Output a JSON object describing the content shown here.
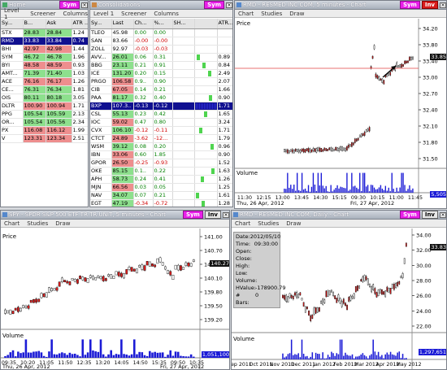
{
  "quotes": {
    "title": "Home",
    "sym_btn": "Sym",
    "menu": [
      "Level 1",
      "Screener",
      "Columns"
    ],
    "columns": [
      "Sy...",
      "B...",
      "Ask",
      "ATR ..."
    ],
    "rows": [
      {
        "sym": "STX",
        "bid": "28.83",
        "ask": "28.84",
        "atr": "1.24",
        "hl": "g"
      },
      {
        "sym": "RMD",
        "bid": "33.83",
        "ask": "33.84",
        "atr": "0.74",
        "hl": "sel"
      },
      {
        "sym": "BHI",
        "bid": "42.97",
        "ask": "42.98",
        "atr": "1.44",
        "hl": "r"
      },
      {
        "sym": "SYM",
        "bid": "46.72",
        "ask": "46.78",
        "atr": "1.96",
        "hl": "g"
      },
      {
        "sym": "BYI",
        "bid": "48.58",
        "ask": "48.59",
        "atr": "0.93",
        "hl": "r"
      },
      {
        "sym": "AMT...",
        "bid": "71.39",
        "ask": "71.40",
        "atr": "1.03",
        "hl": "g"
      },
      {
        "sym": "ACE",
        "bid": "76.16",
        "ask": "76.17",
        "atr": "1.26",
        "hl": "r"
      },
      {
        "sym": "CE...",
        "bid": "76.31",
        "ask": "76.34",
        "atr": "1.81",
        "hl": "g"
      },
      {
        "sym": "OIS",
        "bid": "80.11",
        "ask": "80.18",
        "atr": "3.05",
        "hl": "g"
      },
      {
        "sym": "DLTR",
        "bid": "100.90",
        "ask": "100.94",
        "atr": "1.71",
        "hl": "r"
      },
      {
        "sym": "PPG",
        "bid": "105.54",
        "ask": "105.59",
        "atr": "2.13",
        "hl": "g"
      },
      {
        "sym": "OR...",
        "bid": "105.54",
        "ask": "105.56",
        "atr": "2.34",
        "hl": "g"
      },
      {
        "sym": "PX",
        "bid": "116.08",
        "ask": "116.12",
        "atr": "1.99",
        "hl": "r"
      },
      {
        "sym": "V",
        "bid": "123.31",
        "ask": "123.34",
        "atr": "2.51",
        "hl": "r"
      }
    ]
  },
  "consol": {
    "title": "Consolidations",
    "sym_btn": "Sym",
    "menu": [
      "Level 1",
      "Screener",
      "Columns"
    ],
    "columns": [
      "Sy...",
      "Last",
      "Ch...",
      "%...",
      "SH...",
      "",
      "ATR..."
    ],
    "rows": [
      {
        "sym": "TLEO",
        "last": "45.98",
        "ch": "0.00",
        "pct": "0.00",
        "atr": "",
        "hl": ""
      },
      {
        "sym": "SAN",
        "last": "83.66",
        "ch": "-0.00",
        "pct": "-0.00",
        "atr": "",
        "hl": ""
      },
      {
        "sym": "ZOLL",
        "last": "92.97",
        "ch": "-0.03",
        "pct": "-0.03",
        "atr": "",
        "hl": ""
      },
      {
        "sym": "AVV...",
        "last": "26.01",
        "ch": "0.06",
        "pct": "0.31",
        "atr": "0.89",
        "hl": "g"
      },
      {
        "sym": "BBG",
        "last": "23.11",
        "ch": "0.21",
        "pct": "0.91",
        "atr": "0.84",
        "hl": "g"
      },
      {
        "sym": "ICE",
        "last": "131.20",
        "ch": "0.20",
        "pct": "0.15",
        "atr": "2.49",
        "hl": "g"
      },
      {
        "sym": "PRGO",
        "last": "106.58",
        "ch": "0.9..",
        "pct": "0.90",
        "atr": "2.07",
        "hl": "r"
      },
      {
        "sym": "CIB",
        "last": "67.05",
        "ch": "0.14",
        "pct": "0.21",
        "atr": "1.66",
        "hl": "r"
      },
      {
        "sym": "PAA",
        "last": "81.17",
        "ch": "0.32",
        "pct": "0.40",
        "atr": "0.90",
        "hl": "g"
      },
      {
        "sym": "BXP",
        "last": "107.3..",
        "ch": "-0.13",
        "pct": "-0.12",
        "atr": "1.71",
        "hl": "sel"
      },
      {
        "sym": "CSL",
        "last": "55.13",
        "ch": "0.23",
        "pct": "0.42",
        "atr": "1.65",
        "hl": "g"
      },
      {
        "sym": "IOC",
        "last": "59.02",
        "ch": "0.47",
        "pct": "0.80",
        "atr": "3.24",
        "hl": "r"
      },
      {
        "sym": "CVX",
        "last": "106.10",
        "ch": "-0.12",
        "pct": "-0.11",
        "atr": "1.71",
        "hl": "g"
      },
      {
        "sym": "CTCT",
        "last": "24.89",
        "ch": "-3.62",
        "pct": "-12...",
        "atr": "1.79",
        "hl": "r"
      },
      {
        "sym": "WSM",
        "last": "39.12",
        "ch": "0.08",
        "pct": "0.20",
        "atr": "0.96",
        "hl": "g"
      },
      {
        "sym": "IBN",
        "last": "33.06",
        "ch": "0.60",
        "pct": "1.85",
        "atr": "0.90",
        "hl": "r"
      },
      {
        "sym": "GPOR",
        "last": "26.50",
        "ch": "-0.25",
        "pct": "-0.93",
        "atr": "1.52",
        "hl": "r"
      },
      {
        "sym": "OKE",
        "last": "85.15",
        "ch": "0.1..",
        "pct": "0.22",
        "atr": "1.63",
        "hl": "g"
      },
      {
        "sym": "APH",
        "last": "58.73",
        "ch": "0.24",
        "pct": "0.41",
        "atr": "1.26",
        "hl": "g"
      },
      {
        "sym": "MJN",
        "last": "66.56",
        "ch": "0.03",
        "pct": "0.05",
        "atr": "1.25",
        "hl": "r"
      },
      {
        "sym": "NAV",
        "last": "34.07",
        "ch": "0.07",
        "pct": "0.21",
        "atr": "1.61",
        "hl": "g"
      },
      {
        "sym": "EGT",
        "last": "47.19",
        "ch": "-0.34",
        "pct": "-0.72",
        "atr": "1.28",
        "hl": "g"
      },
      {
        "sym": "SYM",
        "last": "46.69",
        "ch": "1.31",
        "pct": "2.89",
        "atr": "1.96",
        "hl": "g"
      }
    ]
  },
  "rmd5": {
    "title": "RMD - RESMED INC COM, 5 minutes - Chart",
    "sym_btn": "Sym",
    "inv_btn": "Inv",
    "menu": [
      "Chart",
      "Studies",
      "Draw"
    ],
    "price_label": "Price",
    "volume_label": "Volume",
    "last_price": "33.85",
    "volume_tag": "5,505",
    "yticks": [
      "34.20",
      "33.80",
      "33.40",
      "33.00",
      "32.70",
      "32.40",
      "32.10",
      "31.80",
      "31.50"
    ],
    "xticks": [
      "11:30",
      "12:15",
      "13:00",
      "13:45",
      "14:30",
      "15:15",
      "09:30",
      "10:15",
      "11:00",
      "11:45"
    ],
    "date_left": "Thu, 26 Apr, 2012",
    "date_right": "Fri, 27 Apr, 2012"
  },
  "spy": {
    "title": "SPY - SPDR S&P 500 ETF TR TR UNIT, 5 minutes - Chart",
    "sym_btn": "Sym",
    "inv_btn": "Inv",
    "menu": [
      "Chart",
      "Studies",
      "Draw"
    ],
    "price_label": "Price",
    "volume_label": "Volume",
    "last_price": "140.27",
    "volume_tag": "1,051,100",
    "yticks": [
      "141.00",
      "140.70",
      "140.40",
      "140.10",
      "139.80",
      "139.50",
      "139.20"
    ],
    "xticks": [
      "09:35",
      "10:20",
      "11:05",
      "11:50",
      "12:35",
      "13:20",
      "14:05",
      "14:50",
      "15:35",
      "09:50",
      "10:35"
    ],
    "date_left": "Thu, 26 Apr, 2012",
    "date_right": "Fri, 27 Apr, 2012"
  },
  "rmdd": {
    "title": "RMD - RESMED INC COM, Daily - Chart",
    "sym_btn": "Sym",
    "inv_btn": "Inv",
    "menu": [
      "Chart",
      "Studies",
      "Draw"
    ],
    "volume_label": "Volume",
    "last_price": "33.83",
    "volume_tag": "1,297,651",
    "yticks": [
      "34.00",
      "32.00",
      "30.00",
      "28.00",
      "26.00",
      "24.00",
      "22.00"
    ],
    "xticks": [
      "Sep 2011",
      "Oct 2011",
      "Nov 2011",
      "Dec 2011",
      "Jan 2012",
      "Feb 2012",
      "Mar 2012",
      "Apr 2012",
      "May 2012"
    ],
    "tooltip": [
      {
        "k": "Date:",
        "v": "2012/05/10"
      },
      {
        "k": "Time:",
        "v": "09:30:00"
      },
      {
        "k": "Open:",
        "v": ""
      },
      {
        "k": "Close:",
        "v": ""
      },
      {
        "k": "High:",
        "v": ""
      },
      {
        "k": "Low:",
        "v": ""
      },
      {
        "k": "Volume:",
        "v": ""
      },
      {
        "k": "HValue:",
        "v": "-178900.79"
      },
      {
        "k": "# Bars:",
        "v": "0"
      }
    ]
  },
  "colors": {
    "sym": "#e81ee8",
    "inv_red": "#d81c1c",
    "up": "#ffffff",
    "down": "#d81c1c",
    "volume": "#1b1bd6",
    "arrow": "#000000"
  }
}
